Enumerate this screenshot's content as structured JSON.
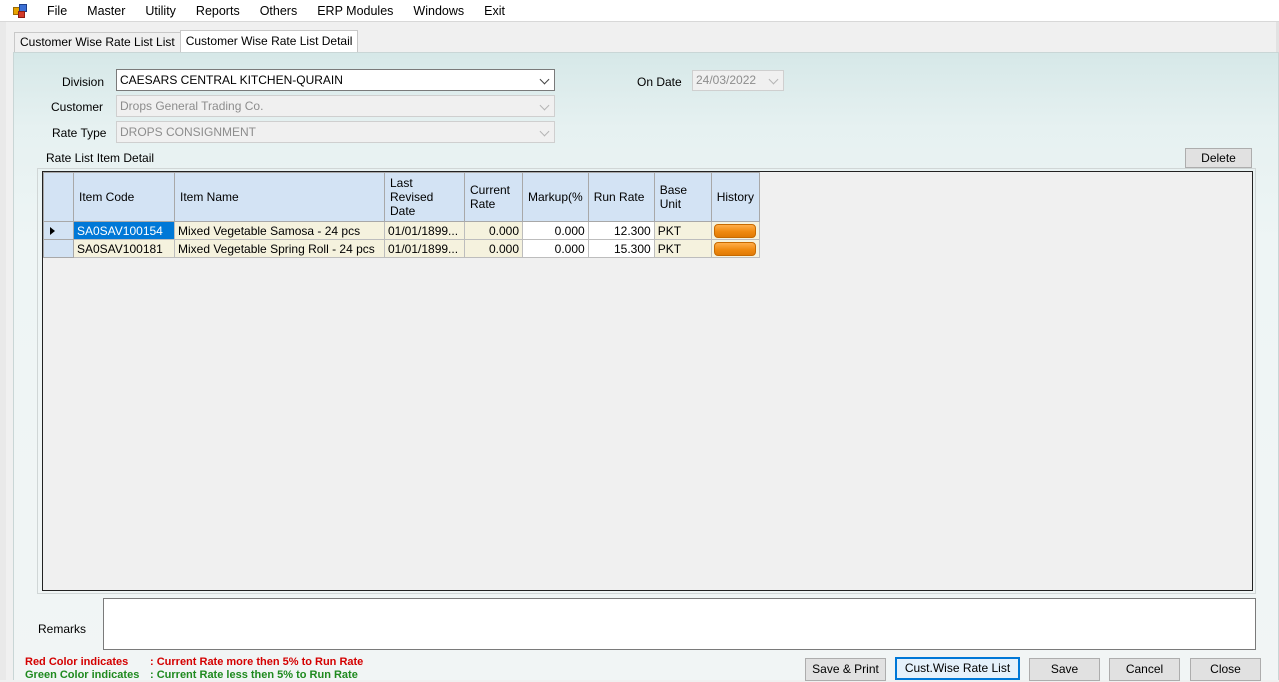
{
  "menu": {
    "items": [
      "File",
      "Master",
      "Utility",
      "Reports",
      "Others",
      "ERP Modules",
      "Windows",
      "Exit"
    ]
  },
  "tabs": [
    {
      "label": "Customer Wise Rate List List",
      "active": false
    },
    {
      "label": "Customer Wise Rate List Detail",
      "active": true
    }
  ],
  "form": {
    "division_label": "Division",
    "division_value": "CAESARS CENTRAL KITCHEN-QURAIN",
    "customer_label": "Customer",
    "customer_value": "Drops General Trading Co.",
    "rate_type_label": "Rate Type",
    "rate_type_value": "DROPS CONSIGNMENT",
    "on_date_label": "On Date",
    "on_date_value": "24/03/2022"
  },
  "grid": {
    "section_label": "Rate List Item Detail",
    "delete_label": "Delete",
    "columns": {
      "item_code": "Item Code",
      "item_name": "Item Name",
      "last_revised_date": "Last Revised Date",
      "current_rate": "Current Rate",
      "markup": "Markup(%",
      "run_rate": "Run Rate",
      "base_unit": "Base Unit",
      "history": "History"
    },
    "rows": [
      {
        "item_code": "SA0SAV100154",
        "item_name": "Mixed Vegetable Samosa - 24 pcs",
        "last_revised_date": "01/01/1899...",
        "current_rate": "0.000",
        "markup": "0.000",
        "run_rate": "12.300",
        "base_unit": "PKT"
      },
      {
        "item_code": "SA0SAV100181",
        "item_name": "Mixed Vegetable Spring Roll - 24 pcs",
        "last_revised_date": "01/01/1899...",
        "current_rate": "0.000",
        "markup": "0.000",
        "run_rate": "15.300",
        "base_unit": "PKT"
      }
    ]
  },
  "remarks": {
    "label": "Remarks",
    "value": ""
  },
  "legend": {
    "red_prefix": "Red Color indicates",
    "red_text": ":  Current Rate more then 5% to Run Rate",
    "green_prefix": "Green Color indicates",
    "green_text": ":  Current Rate less then 5% to Run Rate",
    "red_color": "#d40000",
    "green_color": "#1f8a1f"
  },
  "buttons": {
    "save_print": "Save & Print",
    "cust_wise_rate_list": "Cust.Wise Rate List",
    "save": "Save",
    "cancel": "Cancel",
    "close": "Close"
  },
  "colors": {
    "selection": "#0078d7",
    "header": "#d3e3f4",
    "row_fill": "#f5f2de",
    "history_button": "#f08a10"
  }
}
